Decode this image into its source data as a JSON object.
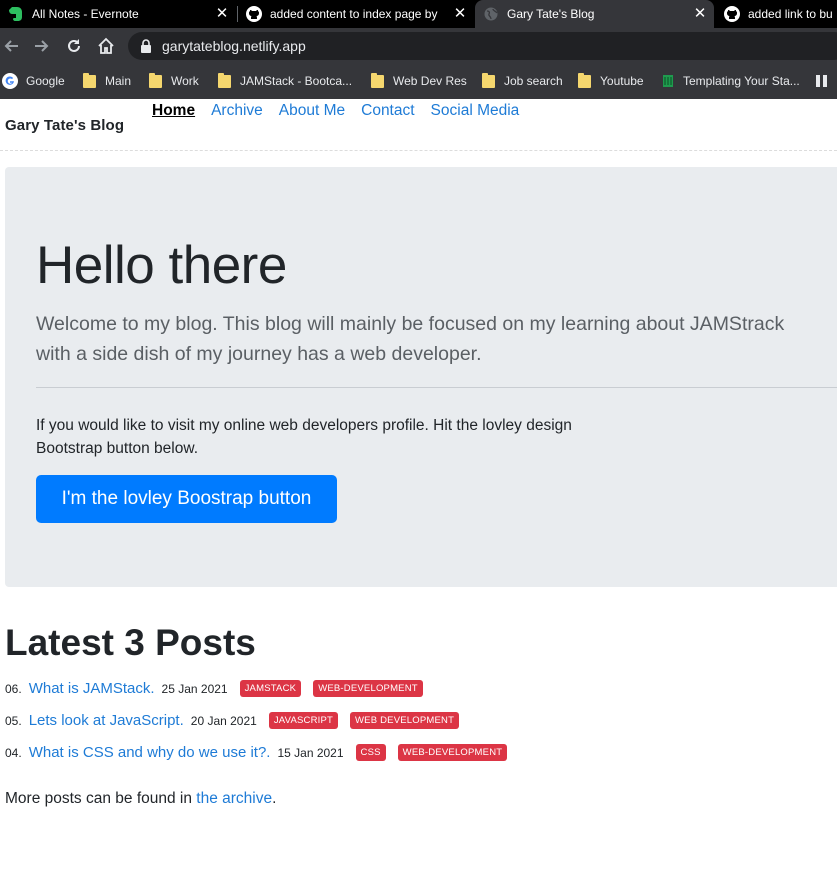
{
  "browser": {
    "tabs": [
      {
        "title": "All Notes - Evernote",
        "icon": "evernote-icon",
        "active": false
      },
      {
        "title": "added content to index page by",
        "icon": "github-icon",
        "active": false
      },
      {
        "title": "Gary Tate's Blog",
        "icon": "globe-icon",
        "active": true
      },
      {
        "title": "added link to bu",
        "icon": "github-icon",
        "active": false
      }
    ],
    "url": "garytateblog.netlify.app",
    "bookmarks": [
      {
        "label": "Google",
        "icon": "google-icon"
      },
      {
        "label": "Main",
        "icon": "folder-icon"
      },
      {
        "label": "Work",
        "icon": "folder-icon"
      },
      {
        "label": "JAMStack - Bootca...",
        "icon": "folder-icon"
      },
      {
        "label": "Web Dev Res",
        "icon": "folder-icon"
      },
      {
        "label": "Job search",
        "icon": "folder-icon"
      },
      {
        "label": "Youtube",
        "icon": "folder-icon"
      },
      {
        "label": "Templating Your Sta...",
        "icon": "bookmark-site-icon"
      }
    ]
  },
  "site": {
    "brand": "Gary Tate's Blog",
    "nav": [
      {
        "label": "Home",
        "current": true
      },
      {
        "label": "Archive",
        "current": false
      },
      {
        "label": "About Me",
        "current": false
      },
      {
        "label": "Contact",
        "current": false
      },
      {
        "label": "Social Media",
        "current": false
      }
    ]
  },
  "hero": {
    "title": "Hello there",
    "lead": "Welcome to my blog. This blog will mainly be focused on my learning about JAMStrack with a side dish of my journey has a web developer.",
    "text": "If you would like to visit my online web developers profile. Hit the lovley design Bootstrap button below.",
    "button": "I'm the lovley Boostrap button"
  },
  "posts_section": {
    "title": "Latest 3 Posts",
    "posts": [
      {
        "num": "06.",
        "title": "What is JAMStack.",
        "date": "25 Jan 2021",
        "tags": [
          "JAMSTACK",
          "WEB-DEVELOPMENT"
        ]
      },
      {
        "num": "05.",
        "title": "Lets look at JavaScript.",
        "date": "20 Jan 2021",
        "tags": [
          "JAVASCRIPT",
          "WEB DEVELOPMENT"
        ]
      },
      {
        "num": "04.",
        "title": "What is CSS and why do we use it?.",
        "date": "15 Jan 2021",
        "tags": [
          "CSS",
          "WEB-DEVELOPMENT"
        ]
      }
    ],
    "more_prefix": "More posts can be found in ",
    "more_link": "the archive",
    "more_suffix": "."
  },
  "colors": {
    "link": "#1e7bd6",
    "button": "#007bff",
    "tag": "#dc3545",
    "jumbotron": "#e9ecef"
  }
}
